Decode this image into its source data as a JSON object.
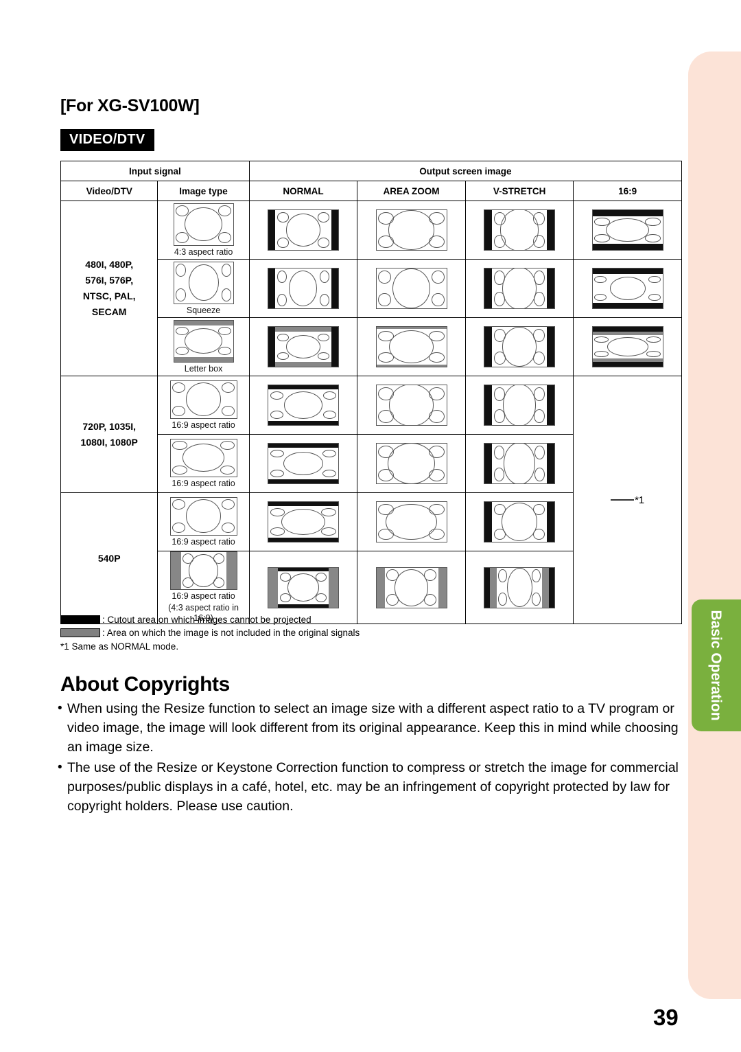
{
  "page": {
    "title": "[For XG-SV100W]",
    "badge": "VIDEO/DTV",
    "number": "39",
    "side_tab": "Basic Operation",
    "side_tab_color": "#7ab03e",
    "panel_color": "#fce3d7"
  },
  "table": {
    "header_top": {
      "input_signal": "Input signal",
      "output_screen_image": "Output screen image"
    },
    "header_cols": {
      "video_dtv": "Video/DTV",
      "image_type": "Image type",
      "normal": "NORMAL",
      "area_zoom": "AREA ZOOM",
      "v_stretch": "V-STRETCH",
      "sixteen_nine": "16:9"
    },
    "groups": [
      {
        "signal": "480I, 480P,\n576I, 576P,\nNTSC, PAL,\nSECAM",
        "signal_lines": [
          "480I, 480P,",
          "576I, 576P,",
          "NTSC, PAL,",
          "SECAM"
        ],
        "rows": [
          {
            "image_type": "4:3 aspect ratio",
            "image_type_sub": ""
          },
          {
            "image_type": "Squeeze",
            "image_type_sub": ""
          },
          {
            "image_type": "Letter box",
            "image_type_sub": ""
          }
        ]
      },
      {
        "signal": "720P, 1035I,\n1080I, 1080P",
        "signal_lines": [
          "720P, 1035I,",
          "1080I, 1080P"
        ],
        "rows": [
          {
            "image_type": "16:9 aspect ratio",
            "image_type_sub": ""
          },
          {
            "image_type": "16:9 aspect ratio",
            "image_type_sub": ""
          }
        ]
      },
      {
        "signal": "540P",
        "signal_lines": [
          "540P"
        ],
        "rows": [
          {
            "image_type": "16:9 aspect ratio",
            "image_type_sub": ""
          },
          {
            "image_type": "16:9 aspect ratio",
            "image_type_sub": "(4:3 aspect ratio in 16:9)"
          }
        ]
      }
    ],
    "merged_cell_note": "*1"
  },
  "legend": {
    "cutout": ": Cutout area on which images cannot be projected",
    "not_included": ": Area on which the image is not included in the original signals",
    "footnote": "*1 Same as NORMAL mode."
  },
  "copyrights": {
    "heading": "About Copyrights",
    "bullet_marker": "•",
    "items": [
      "When using the Resize function to select an image size with a different aspect ratio to a TV program or video image, the image will look different from its original appearance. Keep this in mind while choosing an image size.",
      "The use of the Resize or Keystone Correction function to compress or stretch the image for commercial purposes/public displays in a café, hotel, etc. may be an infringement of copyright protected by law for copyright holders. Please use caution."
    ]
  }
}
